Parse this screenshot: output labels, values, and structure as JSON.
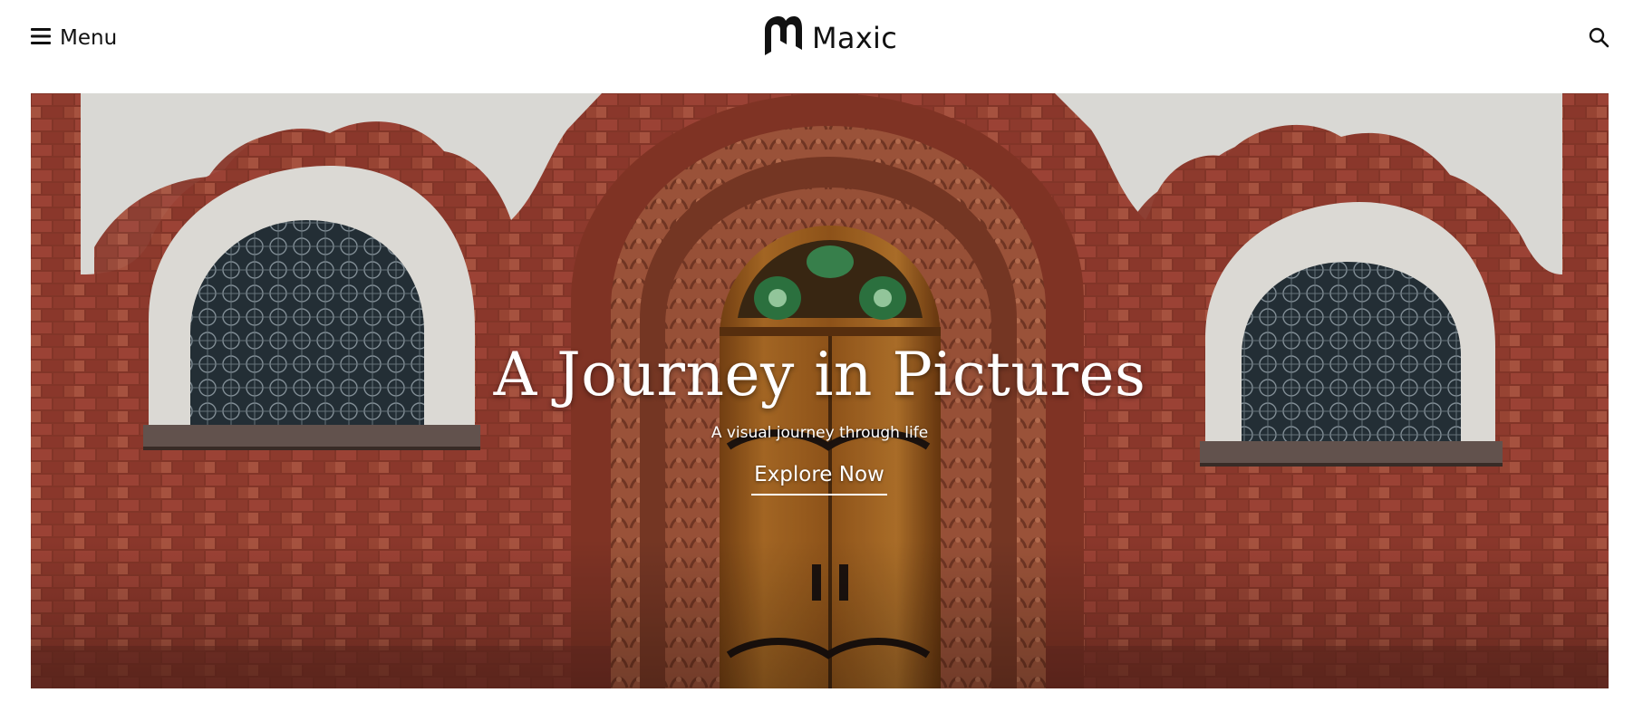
{
  "header": {
    "menu_label": "Menu",
    "brand_name": "Maxic",
    "icons": {
      "menu": "hamburger-icon",
      "logo": "brand-logo-m",
      "search": "search-icon"
    }
  },
  "hero": {
    "title": "A Journey in Pictures",
    "subtitle": "A visual journey through life",
    "cta_label": "Explore Now",
    "image_subject": "Red brick facade with carved arched wooden door and stained-glass windows"
  },
  "colors": {
    "text_dark": "#111111",
    "hero_text": "#ffffff",
    "brick": "#9b4030",
    "wall_white": "#ecebe7",
    "door_wood": "#a7651e"
  }
}
